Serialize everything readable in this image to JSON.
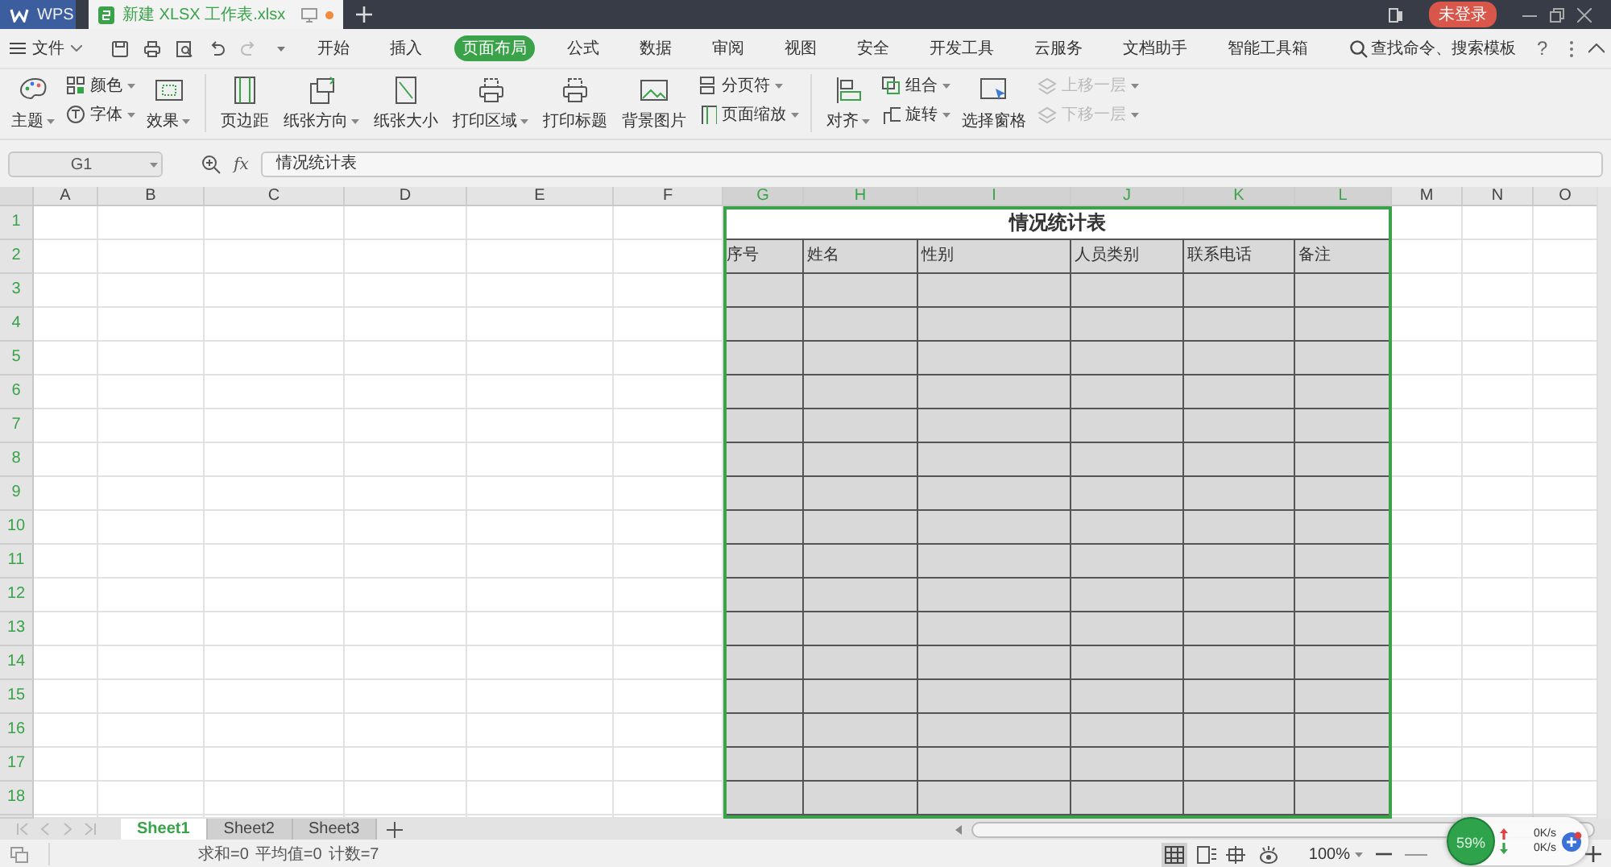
{
  "title_bar": {
    "tabs": [
      {
        "label": "WPS",
        "kind": "app",
        "selected": false
      },
      {
        "label": "新建 XLSX 工作表.xlsx",
        "kind": "file",
        "selected": true
      }
    ],
    "login": "未登录"
  },
  "menu": {
    "file": "文件",
    "tabs": [
      {
        "label": "开始",
        "selected": false
      },
      {
        "label": "插入",
        "selected": false
      },
      {
        "label": "页面布局",
        "selected": true
      },
      {
        "label": "公式",
        "selected": false
      },
      {
        "label": "数据",
        "selected": false
      },
      {
        "label": "审阅",
        "selected": false
      },
      {
        "label": "视图",
        "selected": false
      },
      {
        "label": "安全",
        "selected": false
      },
      {
        "label": "开发工具",
        "selected": false
      },
      {
        "label": "云服务",
        "selected": false
      },
      {
        "label": "文档助手",
        "selected": false
      },
      {
        "label": "智能工具箱",
        "selected": false
      }
    ],
    "search": "查找命令、搜索模板",
    "help": "?"
  },
  "ribbon": [
    [
      {
        "kind": "large",
        "label": "主题",
        "dropdown": true,
        "disabled": false
      },
      {
        "kind": "stack",
        "items": [
          {
            "label": "颜色",
            "dropdown": true,
            "disabled": false
          },
          {
            "label": "字体",
            "dropdown": true,
            "disabled": false
          }
        ]
      },
      {
        "kind": "large",
        "label": "效果",
        "dropdown": true,
        "disabled": false
      }
    ],
    [
      {
        "kind": "large",
        "label": "页边距",
        "dropdown": false,
        "disabled": false
      },
      {
        "kind": "large",
        "label": "纸张方向",
        "dropdown": true,
        "disabled": false
      },
      {
        "kind": "large",
        "label": "纸张大小",
        "dropdown": false,
        "disabled": false
      },
      {
        "kind": "large",
        "label": "打印区域",
        "dropdown": true,
        "disabled": false
      },
      {
        "kind": "large",
        "label": "打印标题",
        "dropdown": false,
        "disabled": false
      },
      {
        "kind": "large",
        "label": "背景图片",
        "dropdown": false,
        "disabled": false
      },
      {
        "kind": "stack",
        "items": [
          {
            "label": "分页符",
            "dropdown": true,
            "disabled": false
          },
          {
            "label": "页面缩放",
            "dropdown": true,
            "disabled": false
          }
        ]
      }
    ],
    [
      {
        "kind": "large",
        "label": "对齐",
        "dropdown": true,
        "disabled": false
      },
      {
        "kind": "stack",
        "items": [
          {
            "label": "组合",
            "dropdown": true,
            "disabled": false
          },
          {
            "label": "旋转",
            "dropdown": true,
            "disabled": false
          }
        ]
      },
      {
        "kind": "large",
        "label": "选择窗格",
        "dropdown": false,
        "disabled": false
      },
      {
        "kind": "stack",
        "items": [
          {
            "label": "上移一层",
            "dropdown": true,
            "disabled": true
          },
          {
            "label": "下移一层",
            "dropdown": true,
            "disabled": true
          }
        ]
      }
    ]
  ],
  "formula_bar": {
    "cell_ref": "G1",
    "fx": "fx",
    "value": "情况统计表"
  },
  "sheet": {
    "columns": [
      {
        "label": "A",
        "selected": false
      },
      {
        "label": "B",
        "selected": false
      },
      {
        "label": "C",
        "selected": false
      },
      {
        "label": "D",
        "selected": false
      },
      {
        "label": "E",
        "selected": false
      },
      {
        "label": "F",
        "selected": false
      },
      {
        "label": "G",
        "selected": true
      },
      {
        "label": "H",
        "selected": true
      },
      {
        "label": "I",
        "selected": true
      },
      {
        "label": "J",
        "selected": true
      },
      {
        "label": "K",
        "selected": true
      },
      {
        "label": "L",
        "selected": true
      },
      {
        "label": "M",
        "selected": false
      },
      {
        "label": "N",
        "selected": false
      },
      {
        "label": "O",
        "selected": false
      }
    ],
    "rows": [
      {
        "label": "1",
        "selected": true
      },
      {
        "label": "2",
        "selected": true
      },
      {
        "label": "3",
        "selected": true
      },
      {
        "label": "4",
        "selected": true
      },
      {
        "label": "5",
        "selected": true
      },
      {
        "label": "6",
        "selected": true
      },
      {
        "label": "7",
        "selected": true
      },
      {
        "label": "8",
        "selected": true
      },
      {
        "label": "9",
        "selected": true
      },
      {
        "label": "10",
        "selected": true
      },
      {
        "label": "11",
        "selected": true
      },
      {
        "label": "12",
        "selected": true
      },
      {
        "label": "13",
        "selected": true
      },
      {
        "label": "14",
        "selected": true
      },
      {
        "label": "15",
        "selected": true
      },
      {
        "label": "16",
        "selected": true
      },
      {
        "label": "17",
        "selected": true
      },
      {
        "label": "18",
        "selected": true
      }
    ],
    "table": {
      "title": "情况统计表",
      "headers": [
        "序号",
        "姓名",
        "性别",
        "人员类别",
        "联系电话",
        "备注"
      ]
    }
  },
  "sheet_tabs": [
    {
      "label": "Sheet1",
      "selected": true
    },
    {
      "label": "Sheet2",
      "selected": false
    },
    {
      "label": "Sheet3",
      "selected": false
    }
  ],
  "status_bar": {
    "stats": [
      "求和=0",
      "平均值=0",
      "计数=7"
    ],
    "zoom": "100%"
  },
  "speed_widget": {
    "percent": "59%",
    "upload": "0K/s",
    "download": "0K/s"
  }
}
